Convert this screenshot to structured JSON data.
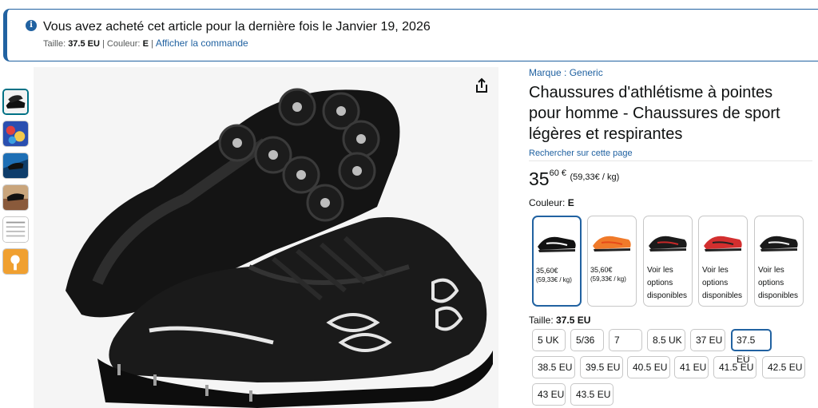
{
  "banner": {
    "message": "Vous avez acheté cet article pour la dernière fois le Janvier 19, 2026",
    "size_prefix": "Taille: ",
    "size_value": "37.5 EU",
    "color_prefix": " Couleur: ",
    "color_value": "E",
    "link": "Afficher la commande"
  },
  "product": {
    "brand": "Marque : Generic",
    "title": "Chaussures d'athlétisme à pointes pour homme - Chaussures de sport légères et respirantes",
    "search_link": "Rechercher sur cette page",
    "price_whole": "35",
    "price_fraction": "60 €",
    "price_per_unit": "(59,33€ / kg)",
    "color_label": "Couleur: ",
    "color_value": "E"
  },
  "swatches": [
    {
      "price": "35,60€",
      "unit": "(59,33€ / kg)",
      "color": "#111111",
      "accent": "#ffffff",
      "selected": true
    },
    {
      "price": "35,60€",
      "unit": "(59,33€ / kg)",
      "color": "#f07a2a",
      "accent": "#e64a19",
      "selected": false
    },
    {
      "line1": "Voir les",
      "line2": "options",
      "line3": "disponibles",
      "color": "#1b1b1b",
      "accent": "#c62828",
      "selected": false
    },
    {
      "line1": "Voir les",
      "line2": "options",
      "line3": "disponibles",
      "color": "#d32f2f",
      "accent": "#222222",
      "selected": false
    },
    {
      "line1": "Voir les",
      "line2": "options",
      "line3": "disponibles",
      "color": "#1a1a1a",
      "accent": "#f2f2f2",
      "selected": false
    }
  ],
  "size": {
    "label": "Taille: ",
    "value": "37.5 EU",
    "options": [
      "5 UK",
      "5/36",
      "7",
      "8.5 UK",
      "37 EU",
      "37.5 EU",
      "38.5 EU",
      "39.5 EU",
      "40.5 EU",
      "41 EU",
      "41.5 EU",
      "42.5 EU",
      "43 EU",
      "43.5 EU"
    ],
    "selected": "37.5 EU"
  },
  "icons": {
    "info": "info-icon",
    "share": "share-icon"
  },
  "colors": {
    "link": "#2162a1",
    "selected_border": "#2162a1"
  }
}
